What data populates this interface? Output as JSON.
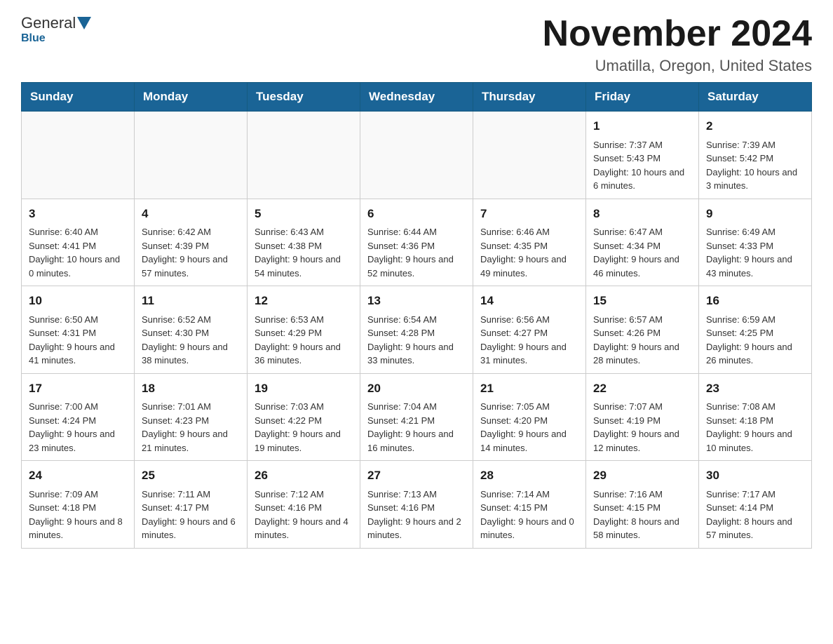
{
  "header": {
    "logo_general": "General",
    "logo_blue": "Blue",
    "title": "November 2024",
    "subtitle": "Umatilla, Oregon, United States"
  },
  "days_of_week": [
    "Sunday",
    "Monday",
    "Tuesday",
    "Wednesday",
    "Thursday",
    "Friday",
    "Saturday"
  ],
  "weeks": [
    {
      "days": [
        {
          "num": "",
          "info": ""
        },
        {
          "num": "",
          "info": ""
        },
        {
          "num": "",
          "info": ""
        },
        {
          "num": "",
          "info": ""
        },
        {
          "num": "",
          "info": ""
        },
        {
          "num": "1",
          "info": "Sunrise: 7:37 AM\nSunset: 5:43 PM\nDaylight: 10 hours and 6 minutes."
        },
        {
          "num": "2",
          "info": "Sunrise: 7:39 AM\nSunset: 5:42 PM\nDaylight: 10 hours and 3 minutes."
        }
      ]
    },
    {
      "days": [
        {
          "num": "3",
          "info": "Sunrise: 6:40 AM\nSunset: 4:41 PM\nDaylight: 10 hours and 0 minutes."
        },
        {
          "num": "4",
          "info": "Sunrise: 6:42 AM\nSunset: 4:39 PM\nDaylight: 9 hours and 57 minutes."
        },
        {
          "num": "5",
          "info": "Sunrise: 6:43 AM\nSunset: 4:38 PM\nDaylight: 9 hours and 54 minutes."
        },
        {
          "num": "6",
          "info": "Sunrise: 6:44 AM\nSunset: 4:36 PM\nDaylight: 9 hours and 52 minutes."
        },
        {
          "num": "7",
          "info": "Sunrise: 6:46 AM\nSunset: 4:35 PM\nDaylight: 9 hours and 49 minutes."
        },
        {
          "num": "8",
          "info": "Sunrise: 6:47 AM\nSunset: 4:34 PM\nDaylight: 9 hours and 46 minutes."
        },
        {
          "num": "9",
          "info": "Sunrise: 6:49 AM\nSunset: 4:33 PM\nDaylight: 9 hours and 43 minutes."
        }
      ]
    },
    {
      "days": [
        {
          "num": "10",
          "info": "Sunrise: 6:50 AM\nSunset: 4:31 PM\nDaylight: 9 hours and 41 minutes."
        },
        {
          "num": "11",
          "info": "Sunrise: 6:52 AM\nSunset: 4:30 PM\nDaylight: 9 hours and 38 minutes."
        },
        {
          "num": "12",
          "info": "Sunrise: 6:53 AM\nSunset: 4:29 PM\nDaylight: 9 hours and 36 minutes."
        },
        {
          "num": "13",
          "info": "Sunrise: 6:54 AM\nSunset: 4:28 PM\nDaylight: 9 hours and 33 minutes."
        },
        {
          "num": "14",
          "info": "Sunrise: 6:56 AM\nSunset: 4:27 PM\nDaylight: 9 hours and 31 minutes."
        },
        {
          "num": "15",
          "info": "Sunrise: 6:57 AM\nSunset: 4:26 PM\nDaylight: 9 hours and 28 minutes."
        },
        {
          "num": "16",
          "info": "Sunrise: 6:59 AM\nSunset: 4:25 PM\nDaylight: 9 hours and 26 minutes."
        }
      ]
    },
    {
      "days": [
        {
          "num": "17",
          "info": "Sunrise: 7:00 AM\nSunset: 4:24 PM\nDaylight: 9 hours and 23 minutes."
        },
        {
          "num": "18",
          "info": "Sunrise: 7:01 AM\nSunset: 4:23 PM\nDaylight: 9 hours and 21 minutes."
        },
        {
          "num": "19",
          "info": "Sunrise: 7:03 AM\nSunset: 4:22 PM\nDaylight: 9 hours and 19 minutes."
        },
        {
          "num": "20",
          "info": "Sunrise: 7:04 AM\nSunset: 4:21 PM\nDaylight: 9 hours and 16 minutes."
        },
        {
          "num": "21",
          "info": "Sunrise: 7:05 AM\nSunset: 4:20 PM\nDaylight: 9 hours and 14 minutes."
        },
        {
          "num": "22",
          "info": "Sunrise: 7:07 AM\nSunset: 4:19 PM\nDaylight: 9 hours and 12 minutes."
        },
        {
          "num": "23",
          "info": "Sunrise: 7:08 AM\nSunset: 4:18 PM\nDaylight: 9 hours and 10 minutes."
        }
      ]
    },
    {
      "days": [
        {
          "num": "24",
          "info": "Sunrise: 7:09 AM\nSunset: 4:18 PM\nDaylight: 9 hours and 8 minutes."
        },
        {
          "num": "25",
          "info": "Sunrise: 7:11 AM\nSunset: 4:17 PM\nDaylight: 9 hours and 6 minutes."
        },
        {
          "num": "26",
          "info": "Sunrise: 7:12 AM\nSunset: 4:16 PM\nDaylight: 9 hours and 4 minutes."
        },
        {
          "num": "27",
          "info": "Sunrise: 7:13 AM\nSunset: 4:16 PM\nDaylight: 9 hours and 2 minutes."
        },
        {
          "num": "28",
          "info": "Sunrise: 7:14 AM\nSunset: 4:15 PM\nDaylight: 9 hours and 0 minutes."
        },
        {
          "num": "29",
          "info": "Sunrise: 7:16 AM\nSunset: 4:15 PM\nDaylight: 8 hours and 58 minutes."
        },
        {
          "num": "30",
          "info": "Sunrise: 7:17 AM\nSunset: 4:14 PM\nDaylight: 8 hours and 57 minutes."
        }
      ]
    }
  ]
}
